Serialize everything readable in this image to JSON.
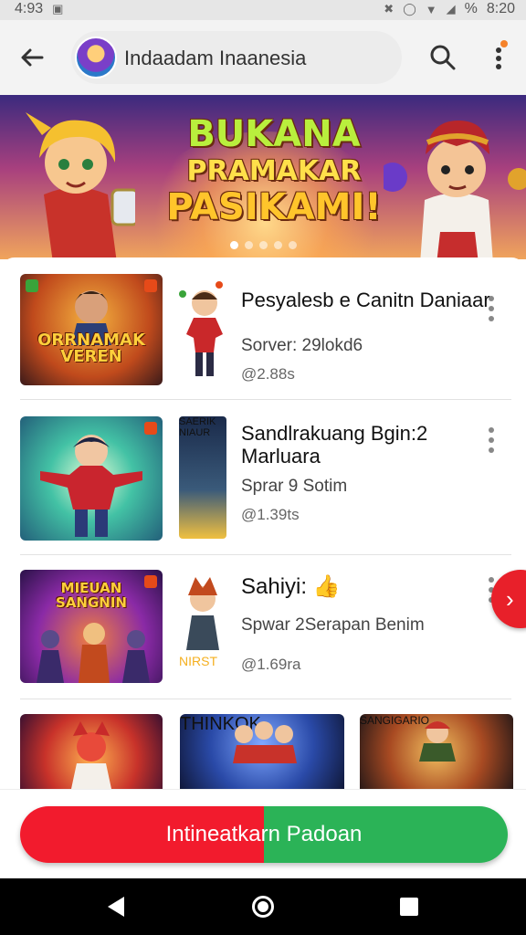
{
  "status_bar": {
    "time_left": "4:93",
    "time_right": "8:20",
    "battery_text": "%"
  },
  "app_bar": {
    "title": "Indaadam Inaanesia",
    "back_icon": "back-arrow-icon",
    "search_icon": "search-icon",
    "menu_icon": "more-vert-icon",
    "notification_color": "#f5822a"
  },
  "banner": {
    "line1": "BUKANA",
    "line2": "PRAMAKAR",
    "line3": "PASIKAMI!",
    "dots_count": 5,
    "active_dot": 0
  },
  "list": [
    {
      "title": "Pesyalesb e Canitn Daniaar",
      "subtitle": "Sorver: 29lokd6",
      "meta": "@2.88s",
      "thumb_caption": "ORRNAMAK VEREN",
      "figure_caption": ""
    },
    {
      "title": "Sandlrakuang Bgin:2 Marluara",
      "subtitle": "Sprar 9 Sotim",
      "meta": "@1.39ts",
      "thumb_caption": "",
      "figure_caption": "SAERIK NIAUR"
    },
    {
      "title": "Sahiyi: 👍",
      "subtitle": "Spwar 2Serapan Benim",
      "meta": "@1.69ra",
      "thumb_caption": "MIEUAN SANGNIN",
      "figure_caption": "NIRST"
    }
  ],
  "strip": [
    {
      "caption": ""
    },
    {
      "caption": "THINKOK"
    },
    {
      "caption": "SANGIGARIO"
    }
  ],
  "cta": {
    "label": "Intineatkarn Padoan",
    "color_left": "#f21b2d",
    "color_right": "#2bb357"
  },
  "fab": {
    "icon": "chevron-right-icon",
    "glyph": "›"
  },
  "nav": {
    "back_icon": "nav-back-icon",
    "home_icon": "nav-home-icon",
    "recents_icon": "nav-recents-icon"
  }
}
